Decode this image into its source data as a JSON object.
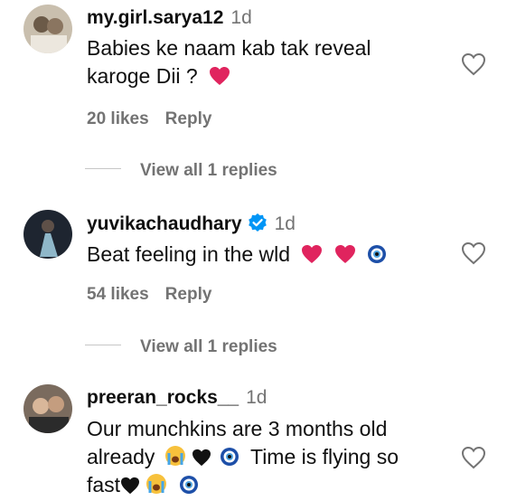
{
  "comments": [
    {
      "username": "my.girl.sarya12",
      "time": "1d",
      "text_line1": "Babies ke naam kab tak reveal",
      "text_line2": "karoge Dii ?",
      "likes": "20 likes",
      "reply": "Reply",
      "view_replies": "View all 1 replies"
    },
    {
      "username": "yuvikachaudhary",
      "time": "1d",
      "text_line1": "Beat feeling in the wld",
      "likes": "54 likes",
      "reply": "Reply",
      "view_replies": "View all 1 replies"
    },
    {
      "username": "preeran_rocks__",
      "time": "1d",
      "text_line1": "Our munchkins are 3 months old",
      "text_line2a": "already",
      "text_line2b": "Time is flying so",
      "text_line3": "fast"
    }
  ],
  "colors": {
    "heart": "#e0245e",
    "verified": "#0095f6",
    "muted": "#737373"
  },
  "icons": [
    "heart-outline-icon",
    "red-heart-emoji",
    "nazar-amulet-emoji",
    "crying-face-emoji",
    "black-heart-emoji",
    "verified-badge-icon"
  ]
}
